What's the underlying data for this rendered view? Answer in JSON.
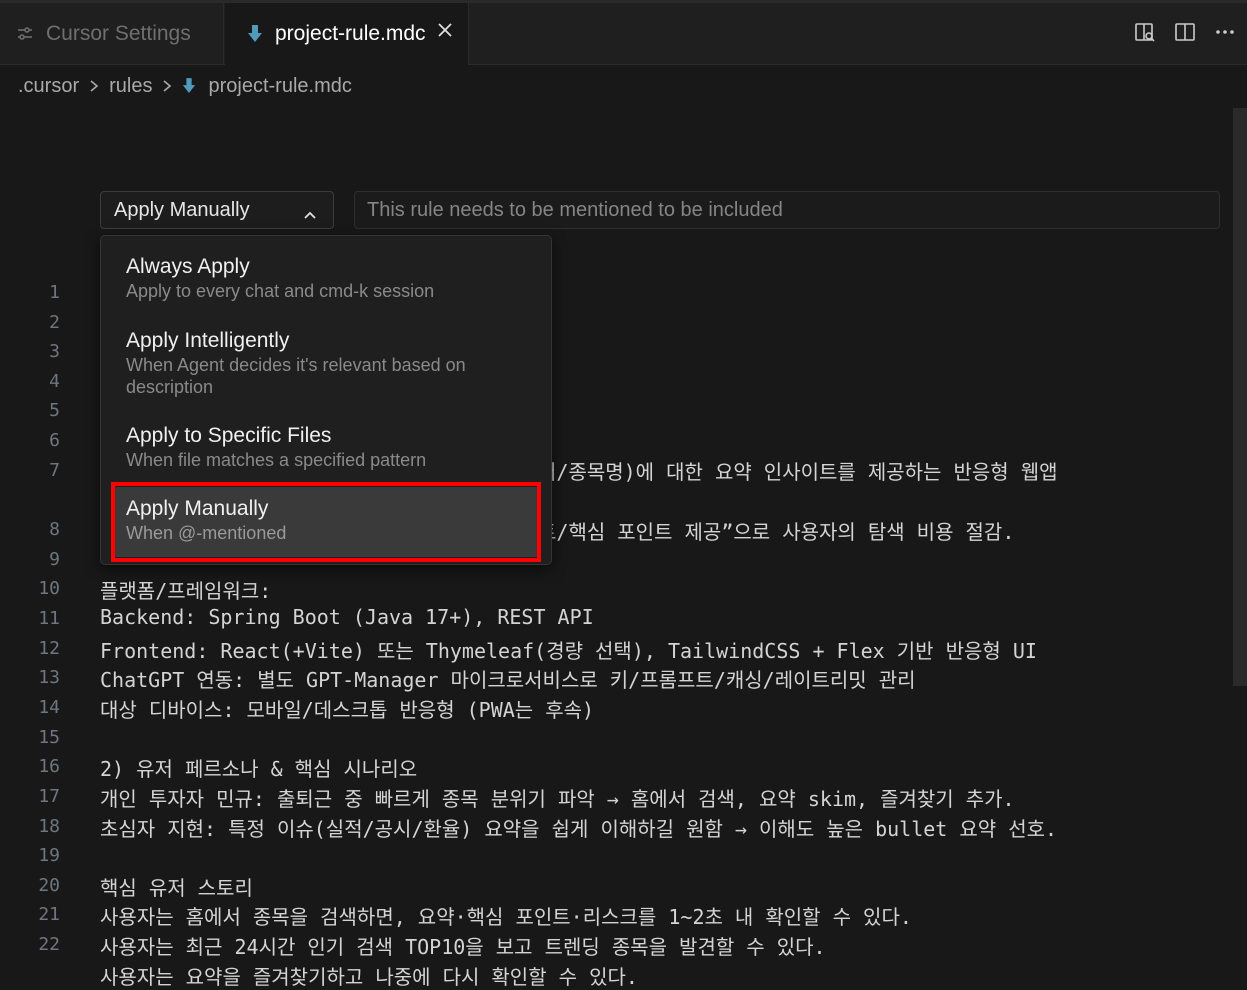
{
  "tabs": [
    {
      "label": "Cursor Settings",
      "icon": "settings-sliders-icon",
      "active": false
    },
    {
      "label": "project-rule.mdc",
      "icon": "mdc-file-icon",
      "active": true
    }
  ],
  "breadcrumb": [
    ".cursor",
    "rules",
    "project-rule.mdc"
  ],
  "rule_type": {
    "selected_label": "Apply Manually",
    "description": "This rule needs to be mentioned to be included"
  },
  "dropdown": {
    "options": [
      {
        "title": "Always Apply",
        "description": "Apply to every chat and cmd-k session"
      },
      {
        "title": "Apply Intelligently",
        "description": "When Agent decides it's relevant based on description"
      },
      {
        "title": "Apply to Specific Files",
        "description": "When file matches a specified pattern"
      },
      {
        "title": "Apply Manually",
        "description": "When @-mentioned"
      }
    ],
    "selected_index": 3
  },
  "line_numbers": [
    "1",
    "2",
    "3",
    "4",
    "5",
    "6",
    "7",
    "8",
    "9",
    "10",
    "11",
    "12",
    "13",
    "14",
    "15",
    "16",
    "17",
    "18",
    "19",
    "20",
    "21",
    "22"
  ],
  "code_lines": [
    "",
    "",
    "",
    "",
    "",
    "",
    "커/종목명)에 대한 요약 인사이트를 제공하는 반응형 웹앱",
    "트/핵심 포인트 제공”으로 사용자의 탐색 비용 절감.",
    "",
    "플랫폼/프레임워크:",
    "Backend: Spring Boot (Java 17+), REST API",
    "Frontend: React(+Vite) 또는 Thymeleaf(경량 선택), TailwindCSS + Flex 기반 반응형 UI",
    "ChatGPT 연동: 별도 GPT-Manager 마이크로서비스로 키/프롬프트/캐싱/레이트리밋 관리",
    "대상 디바이스: 모바일/데스크톱 반응형 (PWA는 후속)",
    "",
    "2) 유저 페르소나 & 핵심 시나리오",
    "개인 투자자 민규: 출퇴근 중 빠르게 종목 분위기 파악 → 홈에서 검색, 요약 skim, 즐겨찾기 추가.",
    "초심자 지현: 특정 이슈(실적/공시/환율) 요약을 쉽게 이해하길 원함 → 이해도 높은 bullet 요약 선호.",
    "",
    "핵심 유저 스토리",
    "사용자는 홈에서 종목을 검색하면, 요약·핵심 포인트·리스크를 1~2초 내 확인할 수 있다.",
    "사용자는 최근 24시간 인기 검색 TOP10을 보고 트렌딩 종목을 발견할 수 있다.",
    "사용자는 요약을 즐겨찾기하고 나중에 다시 확인할 수 있다."
  ],
  "colors": {
    "background": "#181818",
    "highlight_border": "#ff0000",
    "file_icon": "#519aba"
  }
}
